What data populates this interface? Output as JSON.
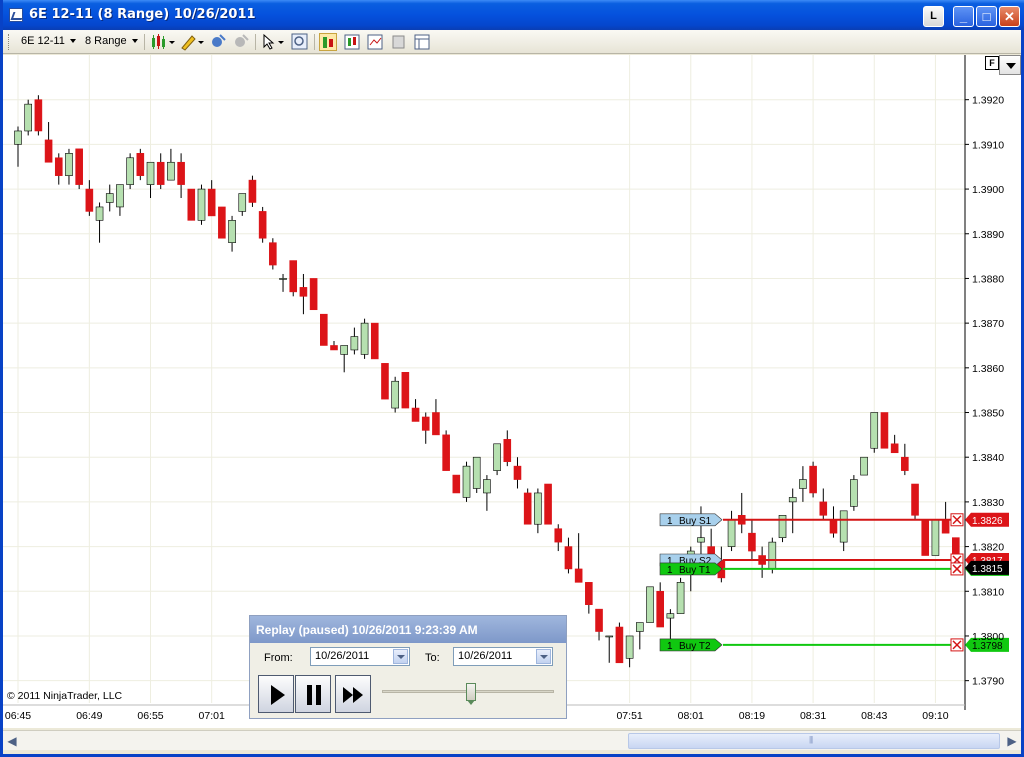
{
  "window": {
    "title": "6E 12-11 (8 Range)  10/26/2011",
    "buttons": {
      "link": "L",
      "minimize": "_",
      "maximize": "□",
      "close": "✕"
    }
  },
  "toolbar": {
    "instrument": "6E 12-11",
    "interval": "8 Range",
    "icons": [
      "candlestick-style-icon",
      "pencil-draw-icon",
      "indicator-add-icon",
      "strategy-icon",
      "pointer-icon",
      "zoom-icon",
      "chart-trader-icon",
      "data-box-icon",
      "properties-icon",
      "snapshot-icon",
      "panel-icon"
    ]
  },
  "chart": {
    "f_label": "F",
    "copyright": "© 2011 NinjaTrader, LLC",
    "colors": {
      "up": "#b6e0b0",
      "down": "#dc1418",
      "buy_line": "#d41414",
      "target_line": "#10c810",
      "stop_label": "#a8d0ec",
      "grid": "#eeeee0"
    }
  },
  "chart_data": {
    "type": "candlestick",
    "instrument": "6E 12-11",
    "interval": "8 Range",
    "ylim": [
      1.3785,
      1.393
    ],
    "y_ticks": [
      "1.3920",
      "1.3910",
      "1.3900",
      "1.3890",
      "1.3880",
      "1.3870",
      "1.3860",
      "1.3850",
      "1.3840",
      "1.3830",
      "1.3820",
      "1.3810",
      "1.3800",
      "1.3790"
    ],
    "x_ticks": [
      "06:45",
      "06:49",
      "06:55",
      "07:01",
      "07:51",
      "08:01",
      "08:19",
      "08:31",
      "08:43",
      "09:10"
    ],
    "candles": [
      {
        "o": 1.391,
        "h": 1.3914,
        "l": 1.3905,
        "c": 1.3913
      },
      {
        "o": 1.3913,
        "h": 1.392,
        "l": 1.3912,
        "c": 1.3919
      },
      {
        "o": 1.392,
        "h": 1.3921,
        "l": 1.3912,
        "c": 1.3913
      },
      {
        "o": 1.3911,
        "h": 1.3915,
        "l": 1.3906,
        "c": 1.3906
      },
      {
        "o": 1.3907,
        "h": 1.3908,
        "l": 1.3901,
        "c": 1.3903
      },
      {
        "o": 1.3903,
        "h": 1.3909,
        "l": 1.3901,
        "c": 1.3908
      },
      {
        "o": 1.3909,
        "h": 1.3909,
        "l": 1.39,
        "c": 1.3901
      },
      {
        "o": 1.39,
        "h": 1.3902,
        "l": 1.3894,
        "c": 1.3895
      },
      {
        "o": 1.3893,
        "h": 1.3897,
        "l": 1.3888,
        "c": 1.3896
      },
      {
        "o": 1.3897,
        "h": 1.3901,
        "l": 1.3895,
        "c": 1.3899
      },
      {
        "o": 1.3896,
        "h": 1.3901,
        "l": 1.3894,
        "c": 1.3901
      },
      {
        "o": 1.3901,
        "h": 1.3908,
        "l": 1.39,
        "c": 1.3907
      },
      {
        "o": 1.3908,
        "h": 1.3909,
        "l": 1.3902,
        "c": 1.3903
      },
      {
        "o": 1.3901,
        "h": 1.3906,
        "l": 1.3898,
        "c": 1.3906
      },
      {
        "o": 1.3906,
        "h": 1.3908,
        "l": 1.39,
        "c": 1.3901
      },
      {
        "o": 1.3902,
        "h": 1.3909,
        "l": 1.3902,
        "c": 1.3906
      },
      {
        "o": 1.3906,
        "h": 1.3908,
        "l": 1.3898,
        "c": 1.3901
      },
      {
        "o": 1.39,
        "h": 1.39,
        "l": 1.3893,
        "c": 1.3893
      },
      {
        "o": 1.3893,
        "h": 1.3901,
        "l": 1.3892,
        "c": 1.39
      },
      {
        "o": 1.39,
        "h": 1.3902,
        "l": 1.3894,
        "c": 1.3894
      },
      {
        "o": 1.3896,
        "h": 1.3896,
        "l": 1.3889,
        "c": 1.3889
      },
      {
        "o": 1.3888,
        "h": 1.3894,
        "l": 1.3886,
        "c": 1.3893
      },
      {
        "o": 1.3895,
        "h": 1.3899,
        "l": 1.3894,
        "c": 1.3899
      },
      {
        "o": 1.3902,
        "h": 1.3903,
        "l": 1.3896,
        "c": 1.3897
      },
      {
        "o": 1.3895,
        "h": 1.3896,
        "l": 1.3888,
        "c": 1.3889
      },
      {
        "o": 1.3888,
        "h": 1.3889,
        "l": 1.3882,
        "c": 1.3883
      },
      {
        "o": 1.388,
        "h": 1.3881,
        "l": 1.3877,
        "c": 1.388
      },
      {
        "o": 1.3884,
        "h": 1.3884,
        "l": 1.3876,
        "c": 1.3877
      },
      {
        "o": 1.3878,
        "h": 1.3881,
        "l": 1.3872,
        "c": 1.3876
      },
      {
        "o": 1.388,
        "h": 1.388,
        "l": 1.3873,
        "c": 1.3873
      },
      {
        "o": 1.3872,
        "h": 1.3872,
        "l": 1.3865,
        "c": 1.3865
      },
      {
        "o": 1.3865,
        "h": 1.3866,
        "l": 1.3864,
        "c": 1.3864
      },
      {
        "o": 1.3863,
        "h": 1.3865,
        "l": 1.3859,
        "c": 1.3865
      },
      {
        "o": 1.3864,
        "h": 1.3869,
        "l": 1.3863,
        "c": 1.3867
      },
      {
        "o": 1.3863,
        "h": 1.3871,
        "l": 1.3862,
        "c": 1.387
      },
      {
        "o": 1.387,
        "h": 1.387,
        "l": 1.3862,
        "c": 1.3862
      },
      {
        "o": 1.3861,
        "h": 1.3861,
        "l": 1.3853,
        "c": 1.3853
      },
      {
        "o": 1.3851,
        "h": 1.3858,
        "l": 1.385,
        "c": 1.3857
      },
      {
        "o": 1.3859,
        "h": 1.3859,
        "l": 1.3851,
        "c": 1.3851
      },
      {
        "o": 1.3851,
        "h": 1.3853,
        "l": 1.3848,
        "c": 1.3848
      },
      {
        "o": 1.3849,
        "h": 1.385,
        "l": 1.3843,
        "c": 1.3846
      },
      {
        "o": 1.385,
        "h": 1.3853,
        "l": 1.3845,
        "c": 1.3845
      },
      {
        "o": 1.3845,
        "h": 1.3846,
        "l": 1.3837,
        "c": 1.3837
      },
      {
        "o": 1.3836,
        "h": 1.3836,
        "l": 1.3832,
        "c": 1.3832
      },
      {
        "o": 1.3831,
        "h": 1.3839,
        "l": 1.383,
        "c": 1.3838
      },
      {
        "o": 1.3833,
        "h": 1.384,
        "l": 1.3832,
        "c": 1.384
      },
      {
        "o": 1.3832,
        "h": 1.3836,
        "l": 1.3828,
        "c": 1.3835
      },
      {
        "o": 1.3837,
        "h": 1.3843,
        "l": 1.3836,
        "c": 1.3843
      },
      {
        "o": 1.3844,
        "h": 1.3846,
        "l": 1.3838,
        "c": 1.3839
      },
      {
        "o": 1.3838,
        "h": 1.384,
        "l": 1.3833,
        "c": 1.3835
      },
      {
        "o": 1.3832,
        "h": 1.3833,
        "l": 1.3825,
        "c": 1.3825
      },
      {
        "o": 1.3825,
        "h": 1.3833,
        "l": 1.3823,
        "c": 1.3832
      },
      {
        "o": 1.3834,
        "h": 1.3834,
        "l": 1.3825,
        "c": 1.3825
      },
      {
        "o": 1.3824,
        "h": 1.3825,
        "l": 1.3819,
        "c": 1.3821
      },
      {
        "o": 1.382,
        "h": 1.3822,
        "l": 1.3814,
        "c": 1.3815
      },
      {
        "o": 1.3815,
        "h": 1.3823,
        "l": 1.3812,
        "c": 1.3812
      },
      {
        "o": 1.3812,
        "h": 1.3812,
        "l": 1.3805,
        "c": 1.3807
      },
      {
        "o": 1.3806,
        "h": 1.3806,
        "l": 1.3799,
        "c": 1.3801
      },
      {
        "o": 1.38,
        "h": 1.38,
        "l": 1.3794,
        "c": 1.38
      },
      {
        "o": 1.3802,
        "h": 1.3803,
        "l": 1.3794,
        "c": 1.3794
      },
      {
        "o": 1.3795,
        "h": 1.38,
        "l": 1.3793,
        "c": 1.38
      },
      {
        "o": 1.3801,
        "h": 1.3803,
        "l": 1.3797,
        "c": 1.3803
      },
      {
        "o": 1.3803,
        "h": 1.3811,
        "l": 1.3803,
        "c": 1.3811
      },
      {
        "o": 1.381,
        "h": 1.3812,
        "l": 1.3802,
        "c": 1.3802
      },
      {
        "o": 1.3804,
        "h": 1.3806,
        "l": 1.3797,
        "c": 1.3805
      },
      {
        "o": 1.3805,
        "h": 1.3813,
        "l": 1.3805,
        "c": 1.3812
      },
      {
        "o": 1.3814,
        "h": 1.382,
        "l": 1.381,
        "c": 1.3819
      },
      {
        "o": 1.3821,
        "h": 1.3829,
        "l": 1.3816,
        "c": 1.3822
      },
      {
        "o": 1.382,
        "h": 1.3824,
        "l": 1.3816,
        "c": 1.3818
      },
      {
        "o": 1.3817,
        "h": 1.382,
        "l": 1.3812,
        "c": 1.3813
      },
      {
        "o": 1.382,
        "h": 1.3828,
        "l": 1.3819,
        "c": 1.3826
      },
      {
        "o": 1.3827,
        "h": 1.3832,
        "l": 1.3823,
        "c": 1.3825
      },
      {
        "o": 1.3823,
        "h": 1.3826,
        "l": 1.3817,
        "c": 1.3819
      },
      {
        "o": 1.3818,
        "h": 1.382,
        "l": 1.3813,
        "c": 1.3816
      },
      {
        "o": 1.3815,
        "h": 1.3822,
        "l": 1.3814,
        "c": 1.3821
      },
      {
        "o": 1.3822,
        "h": 1.3827,
        "l": 1.3821,
        "c": 1.3827
      },
      {
        "o": 1.383,
        "h": 1.3833,
        "l": 1.3823,
        "c": 1.3831
      },
      {
        "o": 1.3833,
        "h": 1.3838,
        "l": 1.383,
        "c": 1.3835
      },
      {
        "o": 1.3838,
        "h": 1.3839,
        "l": 1.3831,
        "c": 1.3832
      },
      {
        "o": 1.383,
        "h": 1.3833,
        "l": 1.3826,
        "c": 1.3827
      },
      {
        "o": 1.3826,
        "h": 1.3829,
        "l": 1.3822,
        "c": 1.3823
      },
      {
        "o": 1.3821,
        "h": 1.3828,
        "l": 1.3819,
        "c": 1.3828
      },
      {
        "o": 1.3829,
        "h": 1.3836,
        "l": 1.3828,
        "c": 1.3835
      },
      {
        "o": 1.3836,
        "h": 1.384,
        "l": 1.3836,
        "c": 1.384
      },
      {
        "o": 1.3842,
        "h": 1.385,
        "l": 1.3841,
        "c": 1.385
      },
      {
        "o": 1.385,
        "h": 1.385,
        "l": 1.3842,
        "c": 1.3842
      },
      {
        "o": 1.3843,
        "h": 1.3845,
        "l": 1.3841,
        "c": 1.3841
      },
      {
        "o": 1.384,
        "h": 1.3843,
        "l": 1.3836,
        "c": 1.3837
      },
      {
        "o": 1.3834,
        "h": 1.3834,
        "l": 1.3826,
        "c": 1.3827
      },
      {
        "o": 1.3826,
        "h": 1.3826,
        "l": 1.3818,
        "c": 1.3818
      },
      {
        "o": 1.3818,
        "h": 1.3826,
        "l": 1.3818,
        "c": 1.3826
      },
      {
        "o": 1.3826,
        "h": 1.383,
        "l": 1.3823,
        "c": 1.3823
      },
      {
        "o": 1.3822,
        "h": 1.3822,
        "l": 1.3815,
        "c": 1.3815
      }
    ],
    "orders": [
      {
        "qty": "1",
        "label": "Buy S1",
        "price": "1.3826",
        "kind": "stop"
      },
      {
        "qty": "1",
        "label": "Buy S2",
        "price": "1.3817",
        "kind": "stop"
      },
      {
        "qty": "1",
        "label": "Buy T1",
        "price": "1.3815",
        "kind": "target"
      },
      {
        "qty": "1",
        "label": "Buy T2",
        "price": "1.3798",
        "kind": "target"
      }
    ],
    "last_price": "1.3815"
  },
  "replay": {
    "title": "Replay (paused) 10/26/2011 9:23:39 AM",
    "from_label": "From:",
    "from_value": "10/26/2011",
    "to_label": "To:",
    "to_value": "10/26/2011",
    "speed_position": 0.52,
    "play_icon": "play-icon",
    "pause_icon": "pause-icon",
    "fast_forward_icon": "fast-forward-icon"
  },
  "scrollbar": {
    "left_arrow": "◀",
    "right_arrow": "▶"
  }
}
